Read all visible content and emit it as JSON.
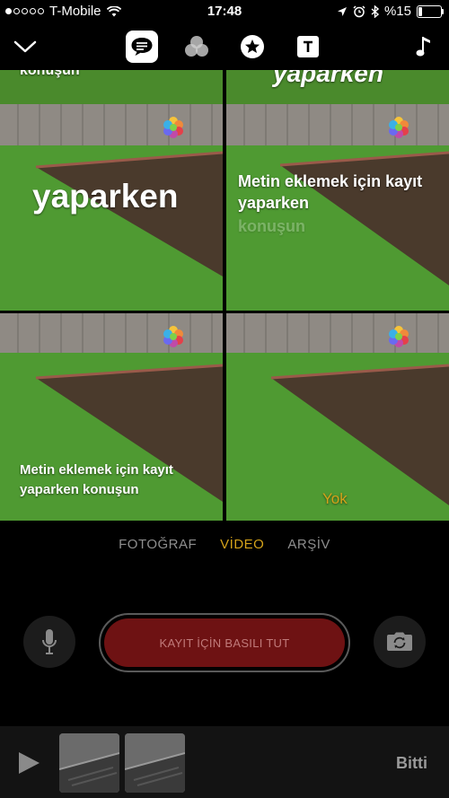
{
  "status_bar": {
    "carrier": "T-Mobile",
    "time": "17:48",
    "battery": "%15",
    "signal_bars": 1
  },
  "toolbar": {
    "icons": [
      "chevron-down-icon",
      "live-titles-icon",
      "filters-icon",
      "stickers-icon",
      "title-posters-icon",
      "music-icon"
    ],
    "active": "live-titles-icon"
  },
  "preview": {
    "cells": [
      {
        "caption_top": "konuşun",
        "caption_main": "yaparken"
      },
      {
        "caption_top": "yaparken",
        "caption_main": "Metin eklemek için kayıt yaparken",
        "caption_sub": "konuşun"
      },
      {
        "caption_main": "Metin eklemek için kayıt yaparken konuşun"
      },
      {
        "caption_main": "Yok"
      }
    ]
  },
  "modes": {
    "photo": "FOTOĞRAF",
    "video": "VİDEO",
    "archive": "ARŞİV",
    "active": "video"
  },
  "controls": {
    "record_label": "KAYIT İÇİN BASILI TUT"
  },
  "bottom": {
    "done_label": "Bitti"
  },
  "colors": {
    "accent": "#d4a21a",
    "record": "#6e1213",
    "grass": "#4f9a32",
    "dirt": "#4a3a2c",
    "fence": "#8f8a84"
  }
}
